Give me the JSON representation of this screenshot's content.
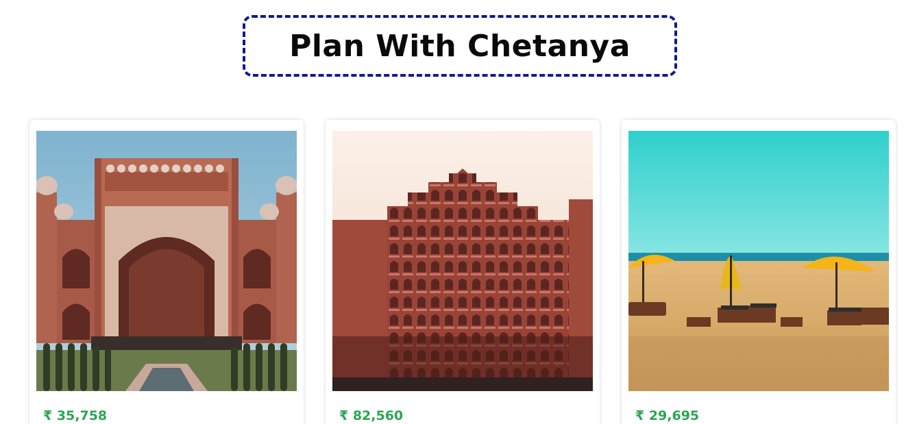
{
  "header": {
    "title": "Plan With Chetanya"
  },
  "colors": {
    "title_border": "#0a1a96",
    "price": "#2aa552"
  },
  "cards": [
    {
      "image": "taj-mahal-gate-photo",
      "price": "₹ 35,758"
    },
    {
      "image": "hawa-mahal-photo",
      "price": "₹ 82,560"
    },
    {
      "image": "beach-umbrellas-photo",
      "price": "₹ 29,695"
    }
  ]
}
